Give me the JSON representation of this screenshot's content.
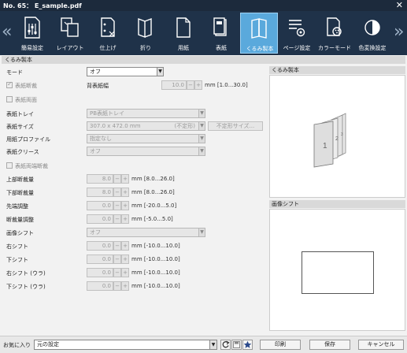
{
  "window": {
    "title": "No. 65： E_sample.pdf",
    "close_glyph": "✕"
  },
  "toolbar": {
    "prev_glyph": "«",
    "next_glyph": "»",
    "items": [
      {
        "label": "簡易設定",
        "icon": "simple-settings-icon"
      },
      {
        "label": "レイアウト",
        "icon": "layout-icon"
      },
      {
        "label": "仕上げ",
        "icon": "finishing-icon"
      },
      {
        "label": "折り",
        "icon": "fold-icon"
      },
      {
        "label": "用紙",
        "icon": "paper-icon"
      },
      {
        "label": "表紙",
        "icon": "cover-icon"
      },
      {
        "label": "くるみ製本",
        "icon": "perfect-binding-icon",
        "active": true
      },
      {
        "label": "ページ設定",
        "icon": "page-settings-icon"
      },
      {
        "label": "カラーモード",
        "icon": "color-mode-icon"
      },
      {
        "label": "色変換設定",
        "icon": "color-conversion-icon"
      }
    ]
  },
  "section_title": "くるみ製本",
  "form": {
    "mode": {
      "label": "モード",
      "value": "オフ"
    },
    "cover_trim": {
      "label": "表紙断裁",
      "checked": true
    },
    "spine_width": {
      "label": "背表紙幅",
      "value": "10.0",
      "unit": "mm [1.0...30.0]"
    },
    "cover_duplex": {
      "label": "表紙両面"
    },
    "cover_tray": {
      "label": "表紙トレイ",
      "value": "PB表紙トレイ"
    },
    "cover_size": {
      "label": "表紙サイズ",
      "value": "307.0 x 472.0 mm",
      "value_note": "(不定形)",
      "button": "不定形サイズ..."
    },
    "paper_profile": {
      "label": "用紙プロファイル",
      "value": "指定なし"
    },
    "cover_crease": {
      "label": "表紙クリース",
      "value": "オフ"
    },
    "cover_edge_trim": {
      "label": "表紙両端断裁"
    },
    "top_trim": {
      "label": "上部断裁量",
      "value": "8.0",
      "unit": "mm [8.0...26.0]"
    },
    "bottom_trim": {
      "label": "下部断裁量",
      "value": "8.0",
      "unit": "mm [8.0...26.0]"
    },
    "front_adjust": {
      "label": "先端調整",
      "value": "0.0",
      "unit": "mm [-20.0...5.0]"
    },
    "trim_adjust": {
      "label": "断裁量調整",
      "value": "0.0",
      "unit": "mm [-5.0...5.0]"
    },
    "image_shift": {
      "label": "画像シフト",
      "value": "オフ"
    },
    "right_shift": {
      "label": "右シフト",
      "value": "0.0",
      "unit": "mm [-10.0...10.0]"
    },
    "down_shift": {
      "label": "下シフト",
      "value": "0.0",
      "unit": "mm [-10.0...10.0]"
    },
    "right_shift_back": {
      "label": "右シフト (ウラ)",
      "value": "0.0",
      "unit": "mm [-10.0...10.0]"
    },
    "down_shift_back": {
      "label": "下シフト (ウラ)",
      "value": "0.0",
      "unit": "mm [-10.0...10.0]"
    }
  },
  "stepper": {
    "minus": "−",
    "plus": "+"
  },
  "dropdown_glyph": "▼",
  "preview": {
    "binding_title": "くるみ製本",
    "page_labels": [
      "1",
      "2",
      "3"
    ],
    "shift_title": "画像シフト"
  },
  "bottom": {
    "favorites_label": "お気に入り",
    "favorites_value": "元の設定",
    "print_label": "印刷",
    "save_label": "保存",
    "cancel_label": "キャンセル"
  },
  "colors": {
    "titlebar": "#1c2a3c",
    "toolbar": "#1f3249",
    "active_tab": "#5aa9dc"
  }
}
